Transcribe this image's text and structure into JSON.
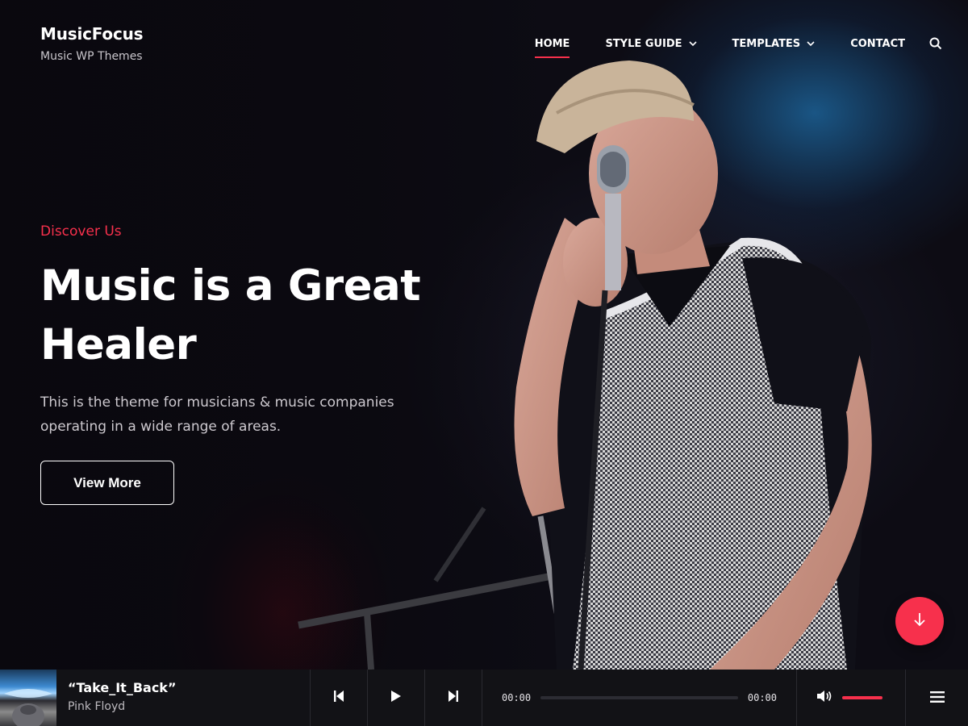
{
  "brand": {
    "title": "MusicFocus",
    "tagline": "Music WP Themes"
  },
  "nav": {
    "items": [
      {
        "label": "HOME",
        "active": true
      },
      {
        "label": "STYLE GUIDE",
        "has_dropdown": true
      },
      {
        "label": "TEMPLATES",
        "has_dropdown": true
      },
      {
        "label": "CONTACT"
      }
    ],
    "search_icon": "search-icon"
  },
  "hero": {
    "eyebrow": "Discover Us",
    "headline": "Music is a Great Healer",
    "description": "This is the theme for musicians & music companies operating in a wide range of areas.",
    "button_label": "View More",
    "scroll_icon": "arrow-down-icon"
  },
  "player": {
    "track_title": "“Take_It_Back”",
    "artist": "Pink Floyd",
    "current_time": "00:00",
    "duration": "00:00",
    "progress": 0,
    "volume": 1.0,
    "icons": [
      "skip-back-icon",
      "play-icon",
      "skip-forward-icon",
      "volume-icon",
      "menu-icon"
    ]
  },
  "colors": {
    "accent": "#f7304c",
    "background": "#0b0a10",
    "player_bg": "#121216"
  }
}
